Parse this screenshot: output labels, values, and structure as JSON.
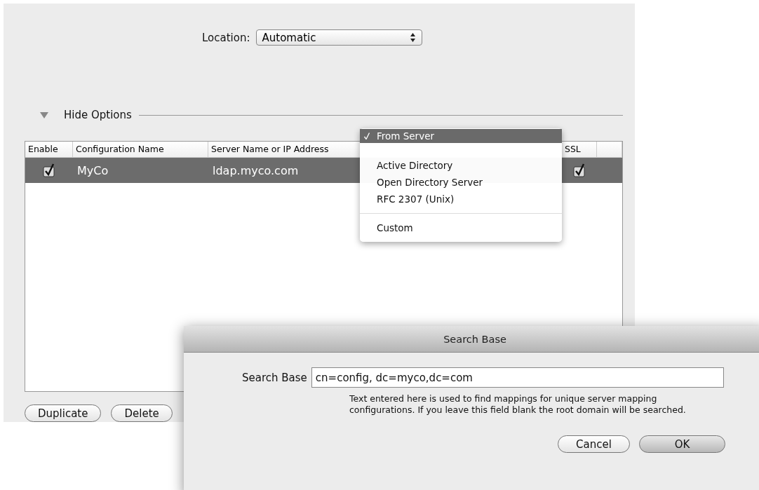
{
  "location": {
    "label": "Location:",
    "value": "Automatic"
  },
  "options_toggle": {
    "label": "Hide Options",
    "expanded": true
  },
  "table": {
    "columns": [
      "Enable",
      "Configuration Name",
      "Server Name or IP Address",
      "SSL"
    ],
    "rows": [
      {
        "enabled": true,
        "name": "MyCo",
        "server": "ldap.myco.com",
        "ssl": true,
        "selected": true
      }
    ]
  },
  "mappings_menu": {
    "items": [
      {
        "kind": "item",
        "label": "From Server",
        "selected": true
      },
      {
        "kind": "item",
        "label": "Active Directory",
        "selected": false
      },
      {
        "kind": "item",
        "label": "Open Directory Server",
        "selected": false
      },
      {
        "kind": "item",
        "label": "RFC 2307 (Unix)",
        "selected": false
      },
      {
        "kind": "separator"
      },
      {
        "kind": "item",
        "label": "Custom",
        "selected": false
      }
    ]
  },
  "buttons": [
    "Duplicate",
    "Delete"
  ],
  "dialog": {
    "title": "Search Base",
    "field_label": "Search Base",
    "value": "cn=config, dc=myco,dc=com",
    "help": "Text entered here is used to find mappings for unique server mapping configurations.  If you leave this field blank the root domain will be searched.",
    "buttons": [
      {
        "label": "Cancel",
        "default": false
      },
      {
        "label": "OK",
        "default": true
      }
    ]
  }
}
